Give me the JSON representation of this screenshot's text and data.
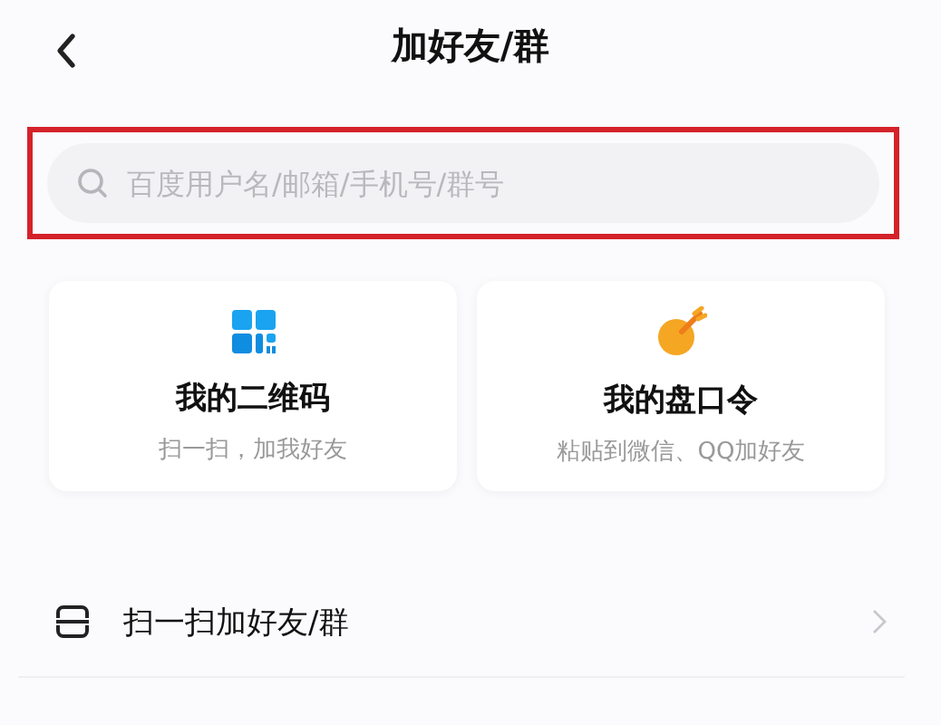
{
  "header": {
    "title": "加好友/群"
  },
  "search": {
    "placeholder": "百度用户名/邮箱/手机号/群号",
    "highlighted": true
  },
  "cards": [
    {
      "kind": "qrcode",
      "title": "我的二维码",
      "subtitle": "扫一扫，加我好友"
    },
    {
      "kind": "passcode",
      "title": "我的盘口令",
      "subtitle": "粘贴到微信、QQ加好友"
    }
  ],
  "list": [
    {
      "kind": "scan",
      "label": "扫一扫加好友/群"
    }
  ]
}
